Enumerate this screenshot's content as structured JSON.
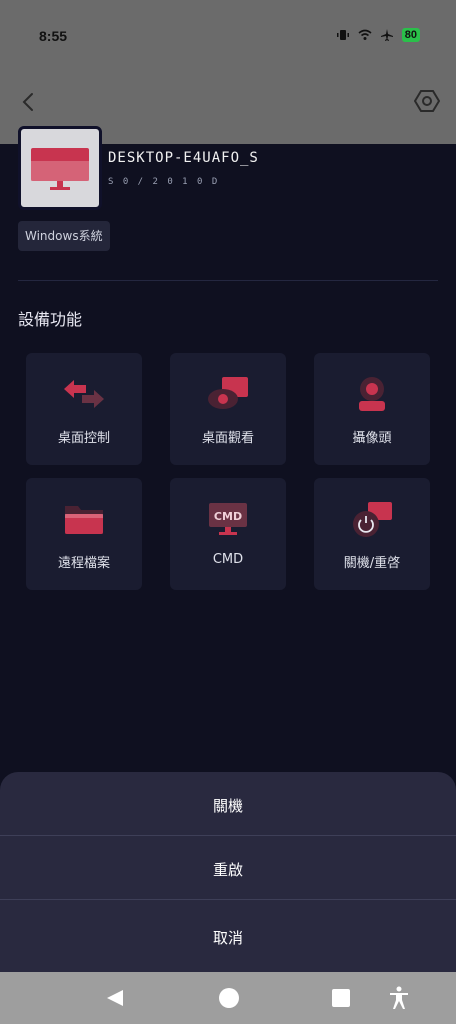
{
  "status_bar": {
    "time": "8:55",
    "battery": "80"
  },
  "app_bar": {
    "back_icon": "chevron-left-icon",
    "settings_icon": "hexagon-settings-icon"
  },
  "device": {
    "name": "DESKTOP-E4UAFO_S",
    "subtitle": "S 0 / 2 0 1 0 D",
    "os_badge": "Windows系統"
  },
  "section_title": "設備功能",
  "functions": [
    {
      "label": "桌面控制",
      "icon": "remote-control-arrows-icon"
    },
    {
      "label": "桌面觀看",
      "icon": "screen-view-eye-icon"
    },
    {
      "label": "攝像頭",
      "icon": "webcam-icon"
    },
    {
      "label": "遠程檔案",
      "icon": "folder-icon"
    },
    {
      "label": "CMD",
      "icon": "cmd-monitor-icon",
      "icon_text": "CMD"
    },
    {
      "label": "關機/重啓",
      "icon": "power-icon"
    }
  ],
  "action_sheet": {
    "items": [
      "關機",
      "重啟",
      "取消"
    ]
  },
  "colors": {
    "accent": "#c8344f",
    "tile_bg": "#1a1c30",
    "sheet_bg": "#29293f"
  }
}
